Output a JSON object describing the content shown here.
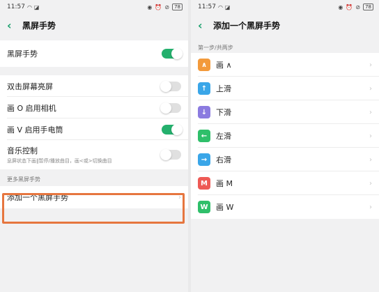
{
  "left": {
    "status": {
      "time": "11:57",
      "battery": "78"
    },
    "header": {
      "title": "黑屏手势"
    },
    "main_toggle": {
      "label": "黑屏手势",
      "on": true
    },
    "toggles": [
      {
        "label": "双击屏幕亮屏",
        "on": false
      },
      {
        "label": "画 O 启用相机",
        "on": false
      },
      {
        "label": "画 V 启用手电筒",
        "on": true
      },
      {
        "label": "音乐控制",
        "sublabel": "息屏状态下画‖暂停/播放曲目，画<或>切换曲目",
        "on": false
      }
    ],
    "section_label": "更多黑屏手势",
    "add_gesture": {
      "label": "添加一个黑屏手势"
    }
  },
  "right": {
    "status": {
      "time": "11:57",
      "battery": "78"
    },
    "header": {
      "title": "添加一个黑屏手势"
    },
    "step_label": "第一步/共两步",
    "gestures": [
      {
        "label": "画 ∧",
        "glyph": "∧",
        "color": "#f39a3b"
      },
      {
        "label": "上滑",
        "glyph": "↑",
        "color": "#3aa6e8"
      },
      {
        "label": "下滑",
        "glyph": "↓",
        "color": "#8b7be0"
      },
      {
        "label": "左滑",
        "glyph": "←",
        "color": "#2fbf6a"
      },
      {
        "label": "右滑",
        "glyph": "→",
        "color": "#3aa6e8"
      },
      {
        "label": "画 M",
        "glyph": "M",
        "color": "#ee5a55"
      },
      {
        "label": "画 W",
        "glyph": "W",
        "color": "#2fbf6a"
      }
    ]
  }
}
